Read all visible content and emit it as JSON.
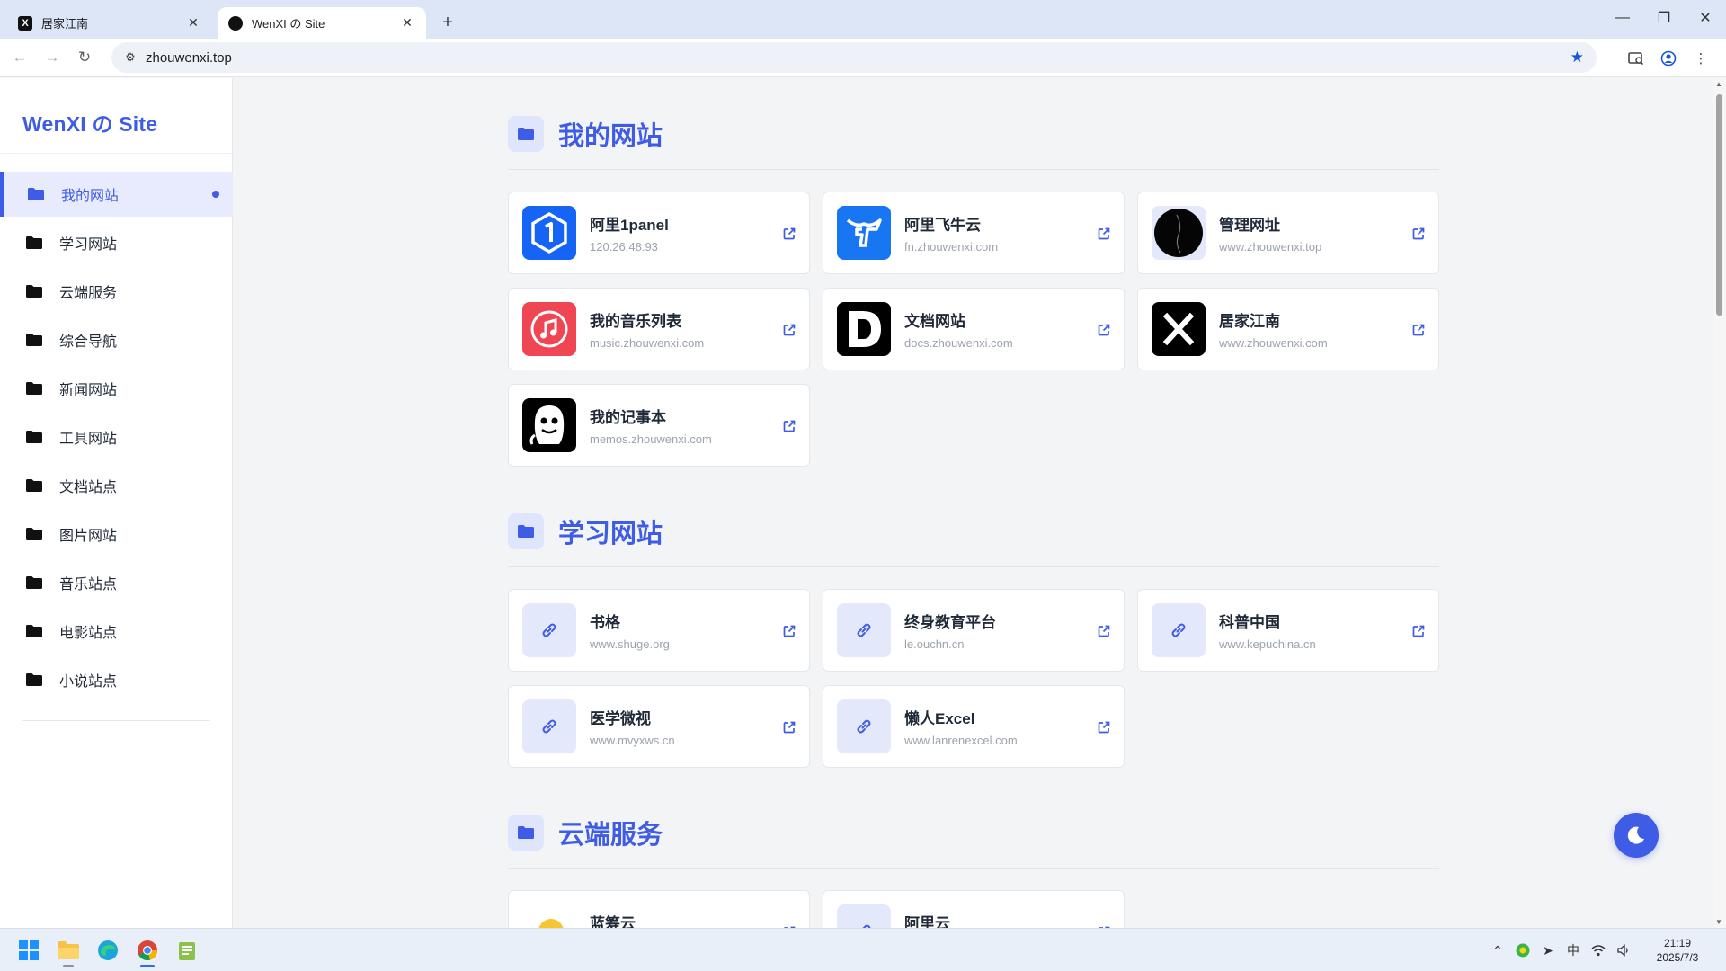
{
  "browser": {
    "tabs": [
      {
        "title": "居家江南",
        "favicon": "X",
        "active": false
      },
      {
        "title": "WenXI の Site",
        "favicon": "",
        "active": true
      }
    ],
    "url": "zhouwenxi.top"
  },
  "sidebar": {
    "logo": "WenXI の Site",
    "items": [
      {
        "label": "我的网站",
        "active": true
      },
      {
        "label": "学习网站",
        "active": false
      },
      {
        "label": "云端服务",
        "active": false
      },
      {
        "label": "综合导航",
        "active": false
      },
      {
        "label": "新闻网站",
        "active": false
      },
      {
        "label": "工具网站",
        "active": false
      },
      {
        "label": "文档站点",
        "active": false
      },
      {
        "label": "图片网站",
        "active": false
      },
      {
        "label": "音乐站点",
        "active": false
      },
      {
        "label": "电影站点",
        "active": false
      },
      {
        "label": "小说站点",
        "active": false
      }
    ]
  },
  "sections": {
    "my": {
      "title": "我的网站",
      "cards": [
        {
          "name": "阿里1panel",
          "url": "120.26.48.93",
          "icon": "1panel-logo"
        },
        {
          "name": "阿里飞牛云",
          "url": "fn.zhouwenxi.com",
          "icon": "feiniu-logo"
        },
        {
          "name": "管理网址",
          "url": "www.zhouwenxi.top",
          "icon": "black-circle-logo"
        },
        {
          "name": "我的音乐列表",
          "url": "music.zhouwenxi.com",
          "icon": "music-note-logo"
        },
        {
          "name": "文档网站",
          "url": "docs.zhouwenxi.com",
          "icon": "letter-d-logo"
        },
        {
          "name": "居家江南",
          "url": "www.zhouwenxi.com",
          "icon": "letter-x-logo"
        },
        {
          "name": "我的记事本",
          "url": "memos.zhouwenxi.com",
          "icon": "memos-logo"
        }
      ]
    },
    "study": {
      "title": "学习网站",
      "cards": [
        {
          "name": "书格",
          "url": "www.shuge.org",
          "icon": "link-icon"
        },
        {
          "name": "终身教育平台",
          "url": "le.ouchn.cn",
          "icon": "link-icon"
        },
        {
          "name": "科普中国",
          "url": "www.kepuchina.cn",
          "icon": "link-icon"
        },
        {
          "name": "医学微视",
          "url": "www.mvyxws.cn",
          "icon": "link-icon"
        },
        {
          "name": "懒人Excel",
          "url": "www.lanrenexcel.com",
          "icon": "link-icon"
        }
      ]
    },
    "cloud": {
      "title": "云端服务",
      "cards": [
        {
          "name": "蓝筹云",
          "url": "",
          "icon": "colorful-cloud-logo"
        },
        {
          "name": "阿里云",
          "url": "",
          "icon": "link-icon"
        }
      ]
    }
  },
  "taskbar": {
    "ime": "中",
    "time": "21:19",
    "date": "2025/7/3"
  },
  "colors": {
    "accent": "#3f5ce6",
    "accent_light": "#e7ebfd",
    "page_bg": "#f3f4f6"
  }
}
